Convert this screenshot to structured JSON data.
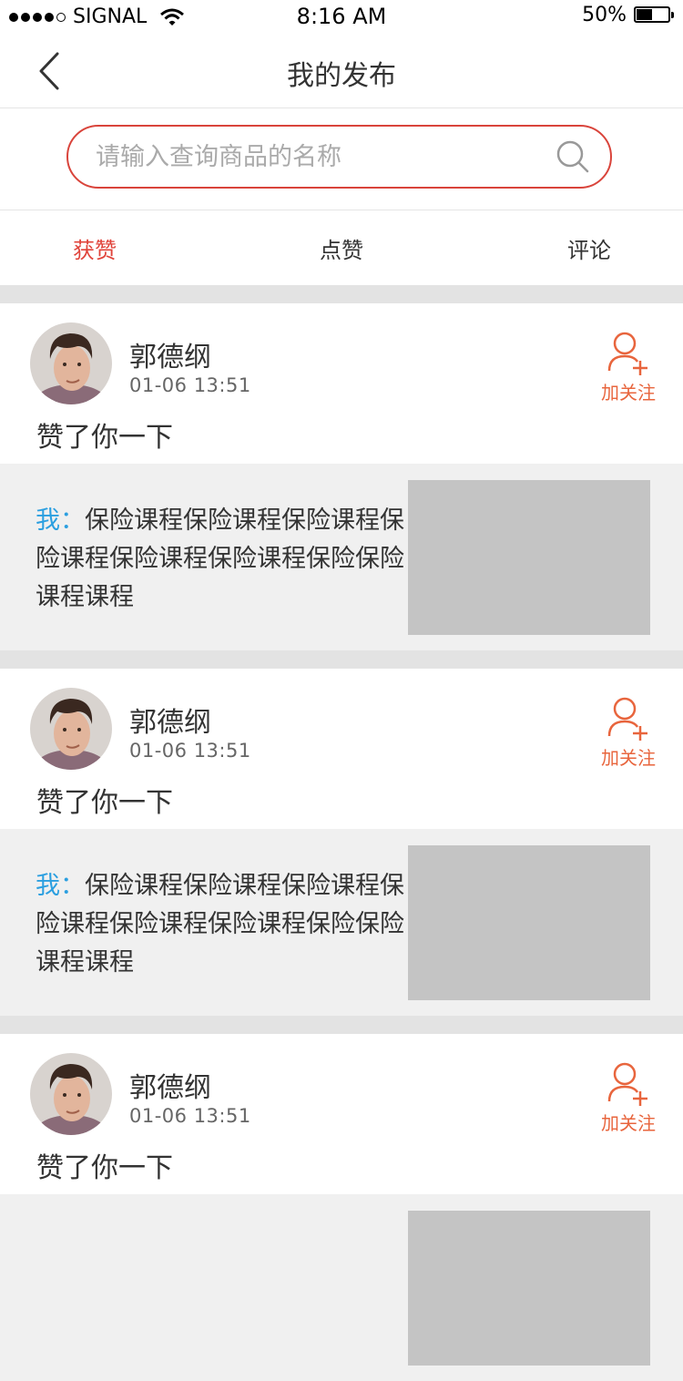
{
  "status_bar": {
    "carrier": "SIGNAL",
    "time": "8:16 AM",
    "battery": "50%",
    "battery_level": 0.5
  },
  "nav": {
    "title": "我的发布",
    "back_icon": "chevron-left-icon"
  },
  "search": {
    "placeholder": "请输入查询商品的名称",
    "icon": "search-icon",
    "border_color": "#d9443b"
  },
  "tabs": [
    {
      "label": "获赞",
      "active": true
    },
    {
      "label": "点赞",
      "active": false
    },
    {
      "label": "评论",
      "active": false
    }
  ],
  "colors": {
    "accent": "#e0433a",
    "follow": "#e8653d",
    "me_label": "#2b9fe0"
  },
  "posts": [
    {
      "user": "郭德纲",
      "time": "01-06  13:51",
      "action": "赞了你一下",
      "follow_label": "加关注",
      "quote_prefix": "我：",
      "quote_body": "保险课程保险课程保险课程保险课程保险课程保险课程保险保险课程课程"
    },
    {
      "user": "郭德纲",
      "time": "01-06  13:51",
      "action": "赞了你一下",
      "follow_label": "加关注",
      "quote_prefix": "我：",
      "quote_body": "保险课程保险课程保险课程保险课程保险课程保险课程保险保险课程课程"
    },
    {
      "user": "郭德纲",
      "time": "01-06  13:51",
      "action": "赞了你一下",
      "follow_label": "加关注"
    }
  ]
}
